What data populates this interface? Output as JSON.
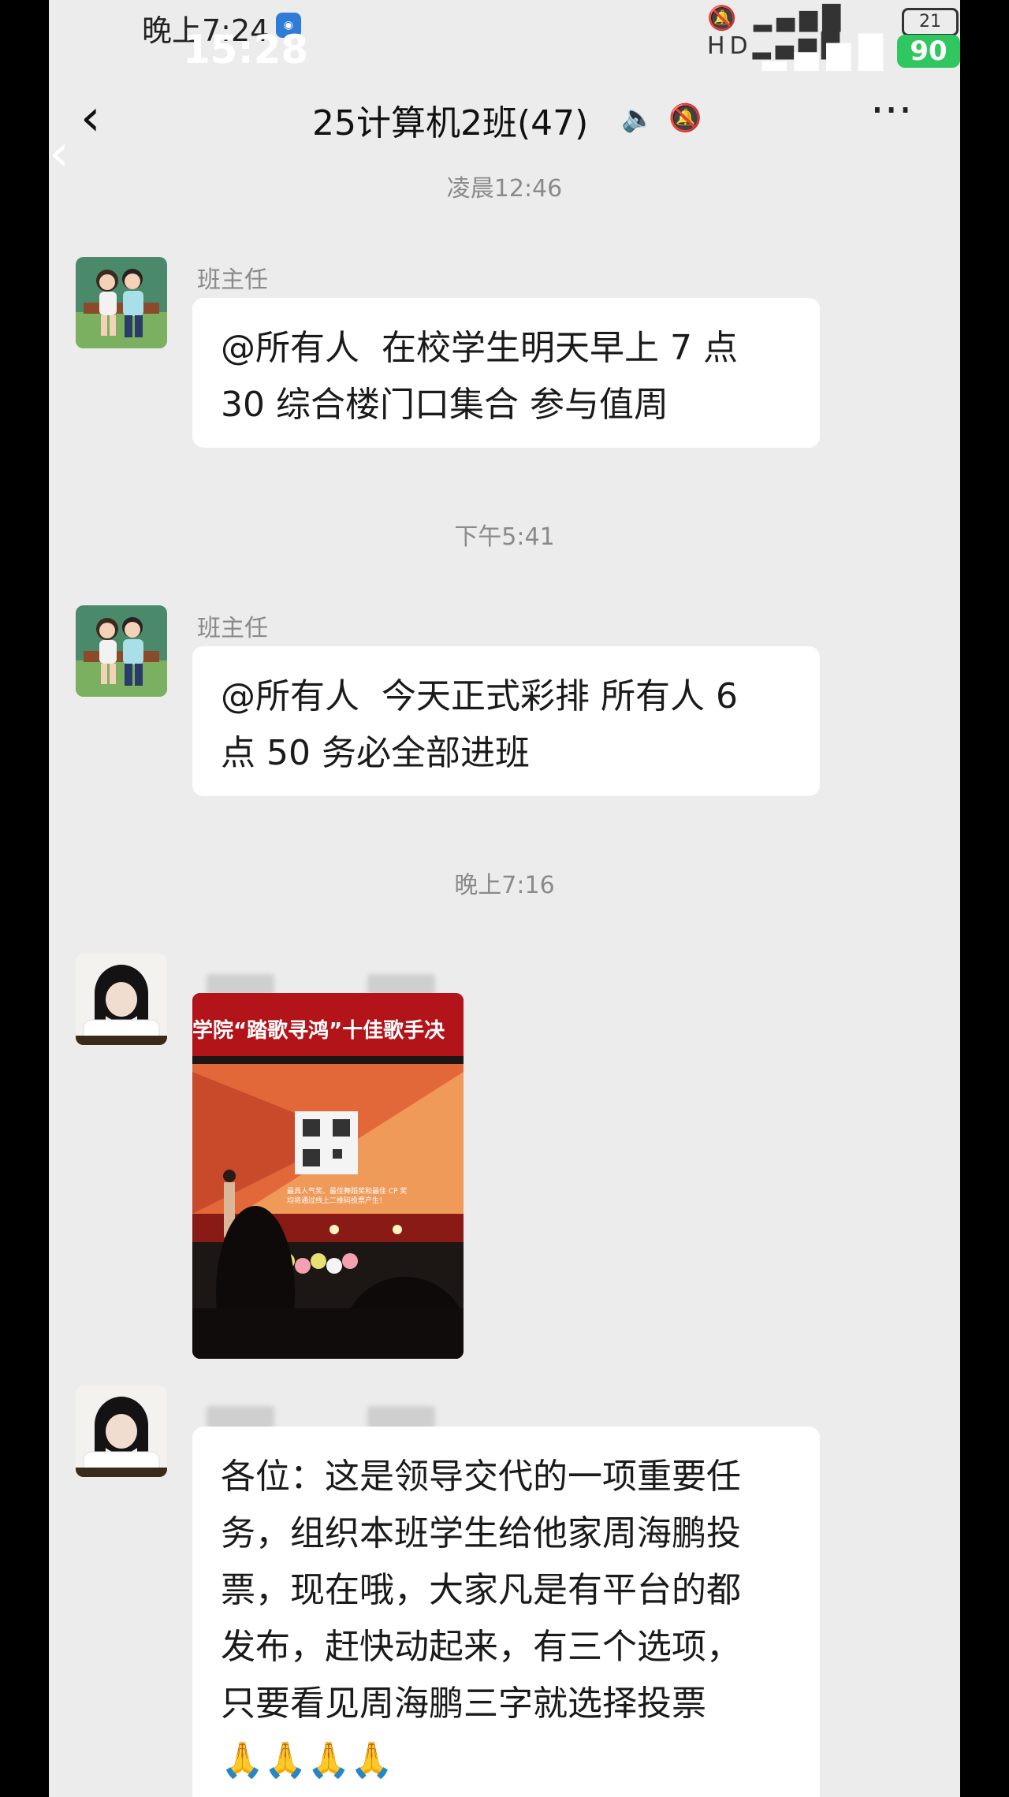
{
  "status_bar": {
    "time_behind": "晚上7:24",
    "time_front": "15:28",
    "battery_behind": "21",
    "battery_front": "90",
    "icons_behind": "🔕 ▂▄▆█ HD▂▄▆█ ≋",
    "icons_front": "▂▄▆█ ≋"
  },
  "header": {
    "back_icon": "‹",
    "title": "25计算机2班(47)",
    "icons": "🔈🔕",
    "more_icon": "···"
  },
  "messages": [
    {
      "timestamp": "凌晨12:46",
      "sender": "班主任",
      "text": "@所有人  在校学生明天早上 7 点\n30 综合楼门口集合 参与值周"
    },
    {
      "timestamp": "下午5:41",
      "sender": "班主任",
      "text": "@所有人  今天正式彩排 所有人 6\n点 50 务必全部进班"
    },
    {
      "timestamp": "晚上7:16",
      "image": {
        "banner_text": "学院“踏歌寻鸿”十佳歌手决",
        "screen_text": "最具人气奖、最佳舞蹈奖和最佳 CP 奖\n均将通过线上二维码投票产生！"
      }
    },
    {
      "text": "各位：这是领导交代的一项重要任\n务，组织本班学生给他家周海鹏投\n票，现在哦，大家凡是有平台的都\n发布，赶快动起来，有三个选项，\n只要看见周海鹏三字就选择投票\n🙏🙏🙏🙏"
    }
  ],
  "colors": {
    "background": "#ececec",
    "bubble": "#ffffff",
    "battery_green": "#31c760",
    "banner_red": "#b3141a"
  }
}
